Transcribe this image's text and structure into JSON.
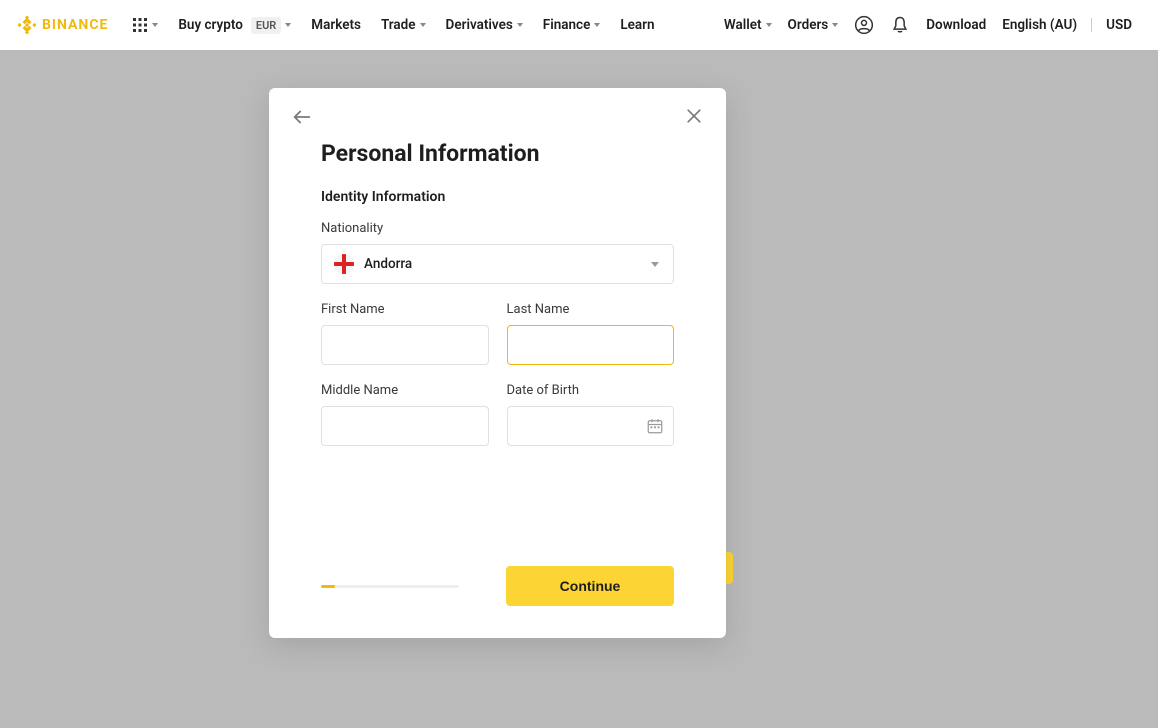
{
  "header": {
    "logo_text": "BINANCE",
    "nav_left": {
      "buy_crypto": "Buy crypto",
      "eur_badge": "EUR",
      "markets": "Markets",
      "trade": "Trade",
      "derivatives": "Derivatives",
      "finance": "Finance",
      "learn": "Learn"
    },
    "nav_right": {
      "wallet": "Wallet",
      "orders": "Orders",
      "download": "Download",
      "language": "English (AU)",
      "currency": "USD"
    }
  },
  "modal": {
    "title": "Personal Information",
    "subtitle": "Identity Information",
    "labels": {
      "nationality": "Nationality",
      "first_name": "First Name",
      "last_name": "Last Name",
      "middle_name": "Middle Name",
      "dob": "Date of Birth"
    },
    "nationality_value": "Andorra",
    "continue": "Continue"
  }
}
